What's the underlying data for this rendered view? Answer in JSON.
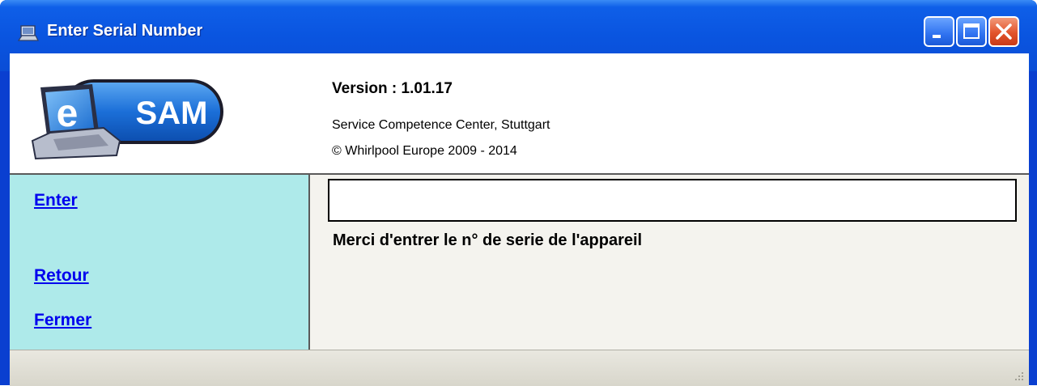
{
  "window": {
    "title": "Enter Serial Number",
    "title_icon": "app-icon",
    "controls": [
      "minimize-icon",
      "maximize-icon",
      "close-icon"
    ]
  },
  "header": {
    "logo": {
      "letter": "e",
      "text": "SAM"
    },
    "version": "Version : 1.01.17",
    "company": "Service Competence Center, Stuttgart",
    "copyright": "© Whirlpool Europe 2009 - 2014"
  },
  "nav": {
    "enter": "Enter",
    "retour": "Retour",
    "fermer": "Fermer"
  },
  "main": {
    "serial_value": "",
    "prompt": "Merci d'entrer le n° de serie de l'appareil"
  },
  "colors": {
    "titlebar": "#0a55e0",
    "nav_background": "#aeeaea",
    "link": "#0000ee",
    "logo_accent": "#1b6fd8"
  }
}
